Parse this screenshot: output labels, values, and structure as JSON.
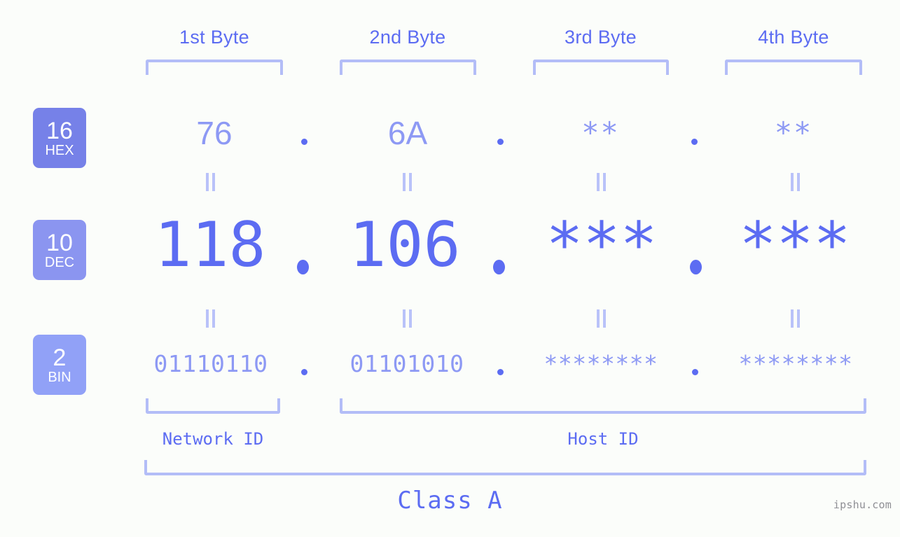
{
  "page": {
    "background_color": "#fbfdfa",
    "accent_color": "#5c6cf2",
    "accent_light_color": "#8d99f4",
    "bracket_color": "#b3bdf7"
  },
  "byte_headers": [
    {
      "label": "1st Byte"
    },
    {
      "label": "2nd Byte"
    },
    {
      "label": "3rd Byte"
    },
    {
      "label": "4th Byte"
    }
  ],
  "rows": [
    {
      "badge_number": "16",
      "badge_tag": "HEX",
      "badge_color": "#7681e8",
      "octets": [
        "76",
        "6A",
        "**",
        "**"
      ],
      "separator": "."
    },
    {
      "badge_number": "10",
      "badge_tag": "DEC",
      "badge_color": "#8b95f0",
      "octets": [
        "118",
        "106",
        "***",
        "***"
      ],
      "separator": "."
    },
    {
      "badge_number": "2",
      "badge_tag": "BIN",
      "badge_color": "#91a1f7",
      "octets": [
        "01110110",
        "01101010",
        "********",
        "********"
      ],
      "separator": "."
    }
  ],
  "equals_marks": {
    "glyph": "||"
  },
  "id_sections": [
    {
      "label": "Network ID"
    },
    {
      "label": "Host ID"
    }
  ],
  "class_label": "Class A",
  "watermark": "ipshu.com"
}
